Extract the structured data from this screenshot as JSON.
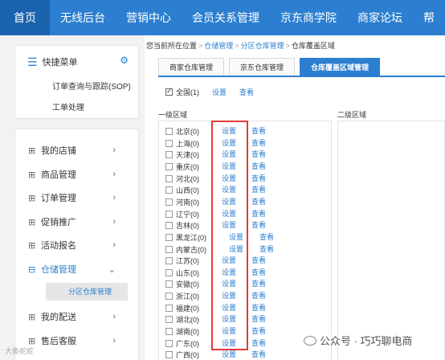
{
  "topnav": {
    "items": [
      {
        "label": "首页"
      },
      {
        "label": "无线后台"
      },
      {
        "label": "营销中心"
      },
      {
        "label": "会员关系管理"
      },
      {
        "label": "京东商学院"
      },
      {
        "label": "商家论坛"
      },
      {
        "label": "帮"
      }
    ]
  },
  "sidebar": {
    "quick_title": "快捷菜单",
    "quick_links": [
      "订单查询与跟踪(SOP)",
      "工单处理"
    ],
    "menu": [
      {
        "label": "我的店铺"
      },
      {
        "label": "商品管理"
      },
      {
        "label": "订单管理"
      },
      {
        "label": "促销推广"
      },
      {
        "label": "活动报名"
      },
      {
        "label": "仓储管理"
      },
      {
        "label": "我的配送"
      },
      {
        "label": "售后客服"
      }
    ],
    "sub_item": "分区仓库管理"
  },
  "breadcrumb": {
    "prefix": "您当前所在位置",
    "items": [
      "仓储管理",
      "分区仓库管理",
      "仓库覆盖区域"
    ]
  },
  "tabs": [
    "商家仓库管理",
    "京东仓库管理",
    "仓库覆盖区域管理"
  ],
  "all_row": {
    "label": "全国(1)",
    "set": "设置",
    "view": "查看"
  },
  "region": {
    "level1": "一级区域",
    "level2": "二级区域"
  },
  "provinces": [
    {
      "name": "北京(0)"
    },
    {
      "name": "上海(0)"
    },
    {
      "name": "天津(0)"
    },
    {
      "name": "重庆(0)"
    },
    {
      "name": "河北(0)"
    },
    {
      "name": "山西(0)"
    },
    {
      "name": "河南(0)"
    },
    {
      "name": "辽宁(0)"
    },
    {
      "name": "吉林(0)"
    },
    {
      "name": "黑龙江(0)"
    },
    {
      "name": "内蒙古(0)"
    },
    {
      "name": "江苏(0)"
    },
    {
      "name": "山东(0)"
    },
    {
      "name": "安徽(0)"
    },
    {
      "name": "浙江(0)"
    },
    {
      "name": "福建(0)"
    },
    {
      "name": "湖北(0)"
    },
    {
      "name": "湖南(0)"
    },
    {
      "name": "广东(0)"
    },
    {
      "name": "广西(0)"
    }
  ],
  "link_labels": {
    "set": "设置",
    "view": "查看"
  },
  "watermark": "公众号 · 巧巧聊电商",
  "corner_mark": "大鱼蛇蛇",
  "colors": {
    "nav": "#2c7fd0",
    "nav_active": "#1b63ad",
    "link": "#2c7fd0",
    "highlight": "#e23b3b"
  }
}
